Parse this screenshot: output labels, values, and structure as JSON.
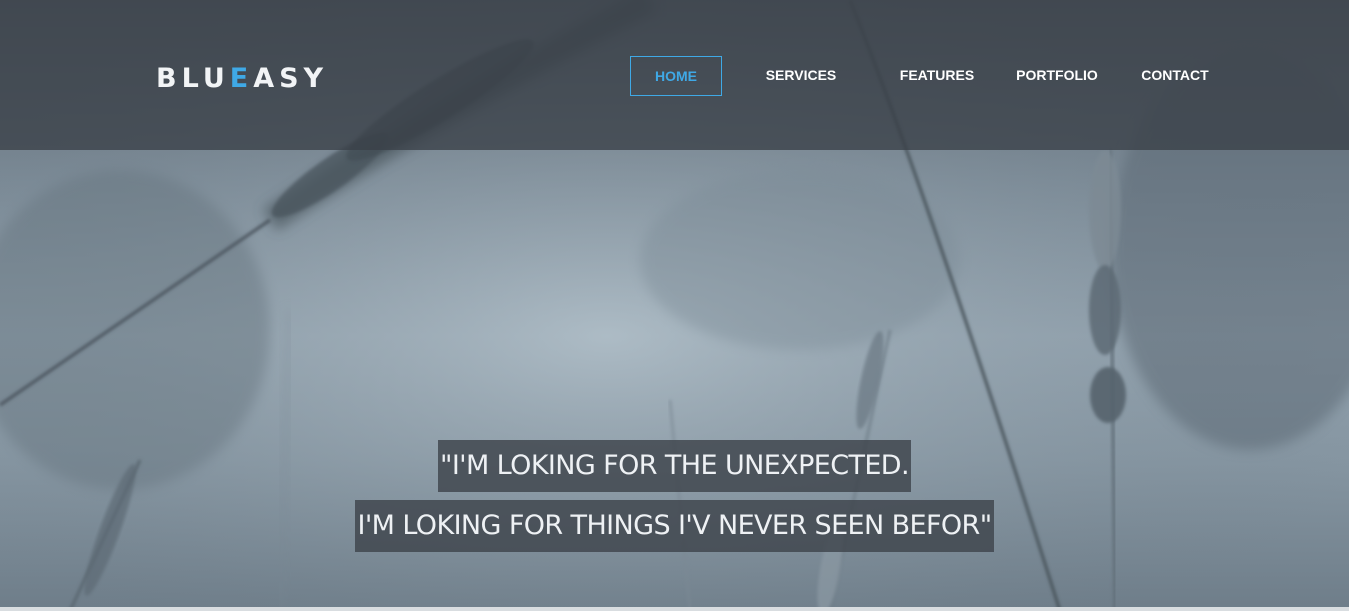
{
  "brand": {
    "logo_part1": "BLU",
    "logo_accent": "E",
    "logo_part2": "ASY",
    "accent_color": "#3fa9e6"
  },
  "nav": {
    "items": [
      {
        "label": "HOME",
        "active": true
      },
      {
        "label": "SERVICES",
        "active": false
      },
      {
        "label": "FEATURES",
        "active": false
      },
      {
        "label": "PORTFOLIO",
        "active": false
      },
      {
        "label": "CONTACT",
        "active": false
      }
    ]
  },
  "hero": {
    "quote_line1": "\"I'M LOKING FOR THE UNEXPECTED.",
    "quote_line2": "I'M LOKING FOR THINGS I'V NEVER SEEN BEFOR\"",
    "background": "blurred-wheat-field-image"
  },
  "colors": {
    "header_bg": "#3a4048",
    "quote_bg": "#3e444c",
    "text": "#ffffff"
  }
}
